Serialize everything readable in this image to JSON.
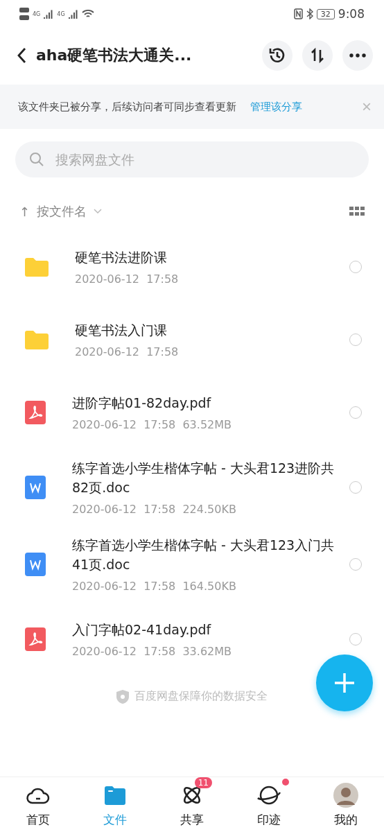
{
  "status_bar": {
    "network_1": "4G",
    "network_2": "4G",
    "battery": "32",
    "time": "9:08"
  },
  "header": {
    "title": "aha硬笔书法大通关..."
  },
  "share_notice": {
    "text": "该文件夹已被分享，后续访问者可同步查看更新",
    "link": "管理该分享",
    "close": "×"
  },
  "search": {
    "placeholder": "搜索网盘文件"
  },
  "sort": {
    "arrow": "↑",
    "label": "按文件名"
  },
  "files": [
    {
      "kind": "folder",
      "name": "硬笔书法进阶课",
      "date": "2020-06-12",
      "time": "17:58",
      "selected": false
    },
    {
      "kind": "folder",
      "name": "硬笔书法入门课",
      "date": "2020-06-12",
      "time": "17:58",
      "selected": false
    },
    {
      "kind": "pdf",
      "name": "进阶字帖01-82day.pdf",
      "date": "2020-06-12",
      "time": "17:58",
      "size": "63.52MB",
      "selected": false
    },
    {
      "kind": "doc",
      "name": "练字首选小学生楷体字帖 - 大头君123进阶共82页.doc",
      "date": "2020-06-12",
      "time": "17:58",
      "size": "224.50KB",
      "selected": false
    },
    {
      "kind": "doc",
      "name": "练字首选小学生楷体字帖 - 大头君123入门共41页.doc",
      "date": "2020-06-12",
      "time": "17:58",
      "size": "164.50KB",
      "selected": false
    },
    {
      "kind": "pdf",
      "name": "入门字帖02-41day.pdf",
      "date": "2020-06-12",
      "time": "17:58",
      "size": "33.62MB",
      "selected": false
    }
  ],
  "footer_note": "百度网盘保障你的数据安全",
  "tabs": [
    {
      "kind": "home",
      "label": "首页",
      "selected": false
    },
    {
      "kind": "files",
      "label": "文件",
      "selected": true
    },
    {
      "kind": "share",
      "label": "共享",
      "selected": false,
      "badge": "11"
    },
    {
      "kind": "planet",
      "label": "印迹",
      "selected": false,
      "dot": true
    },
    {
      "kind": "avatar",
      "label": "我的",
      "selected": false
    }
  ]
}
